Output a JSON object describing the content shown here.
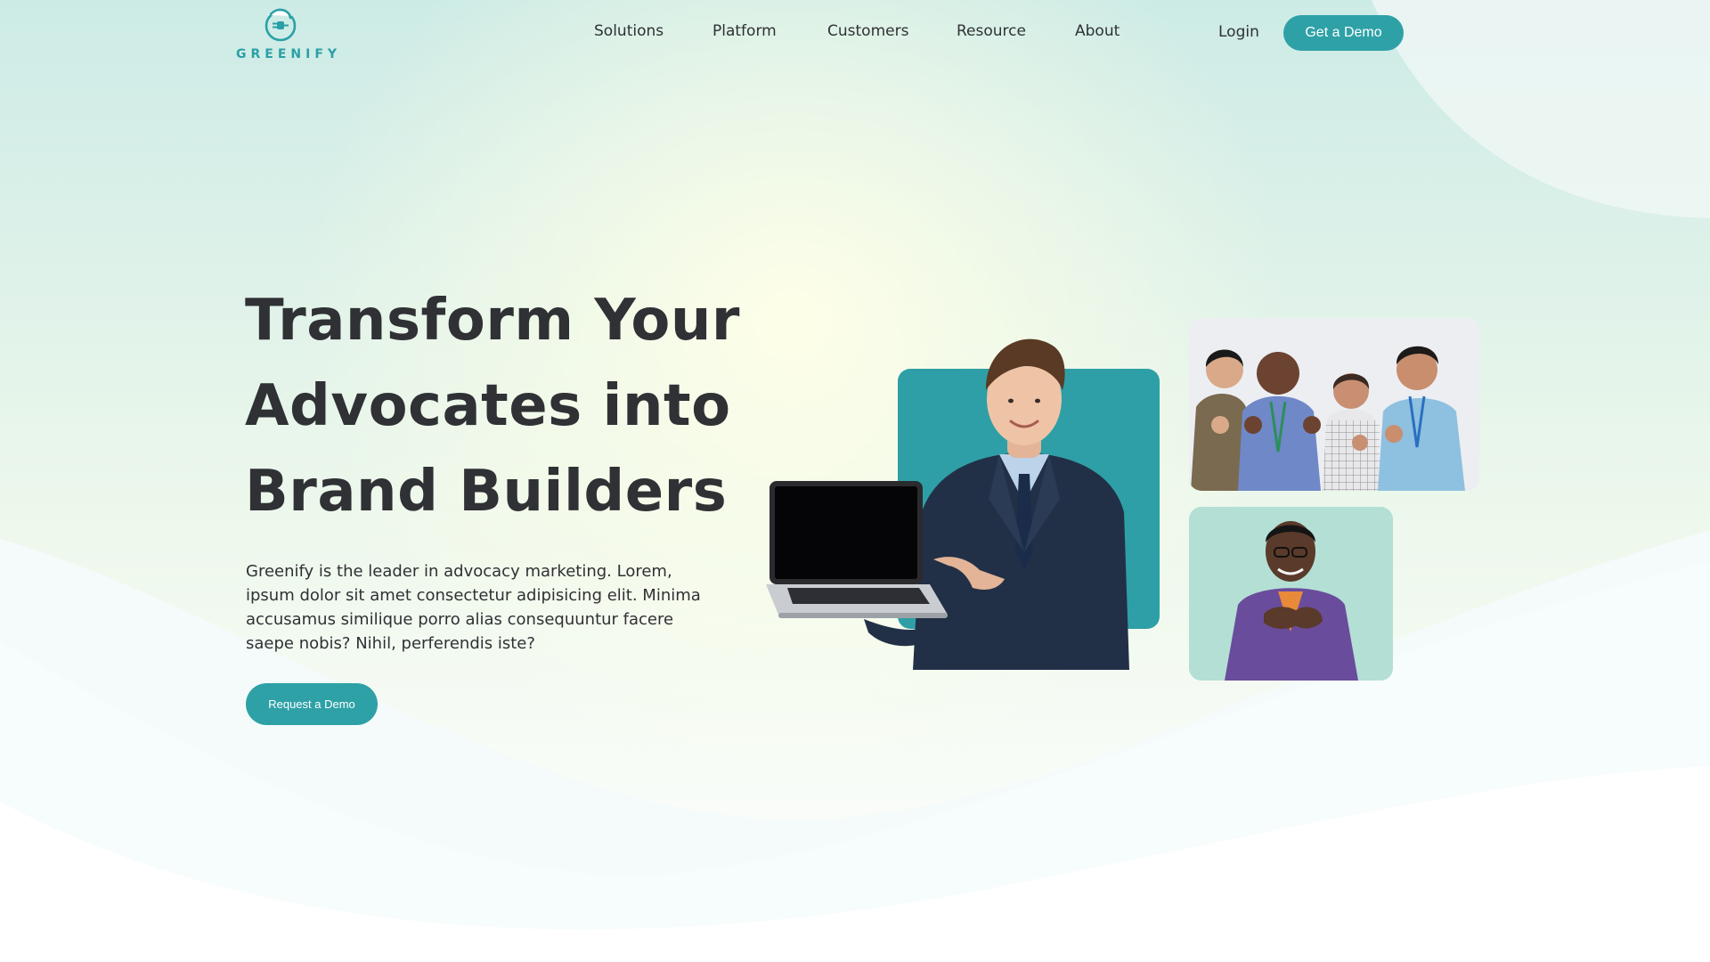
{
  "brand": {
    "name": "GREENIFY",
    "accent": "#2ea1a7"
  },
  "nav": {
    "items": [
      {
        "label": "Solutions"
      },
      {
        "label": "Platform"
      },
      {
        "label": "Customers"
      },
      {
        "label": "Resource"
      },
      {
        "label": "About"
      }
    ],
    "login_label": "Login",
    "demo_label": "Get a Demo"
  },
  "hero": {
    "headline_lines": [
      "Transform Your",
      "Advocates into",
      "Brand Builders"
    ],
    "lead": "Greenify is the leader in advocacy marketing. Lorem, ipsum dolor sit amet consectetur adipisicing elit. Minima accusamus similique porro alias consequuntur facere saepe nobis? Nihil, perferendis iste?",
    "cta_label": "Request a Demo"
  },
  "icons": {
    "logo": "greenify-leaf-plug-logo"
  }
}
